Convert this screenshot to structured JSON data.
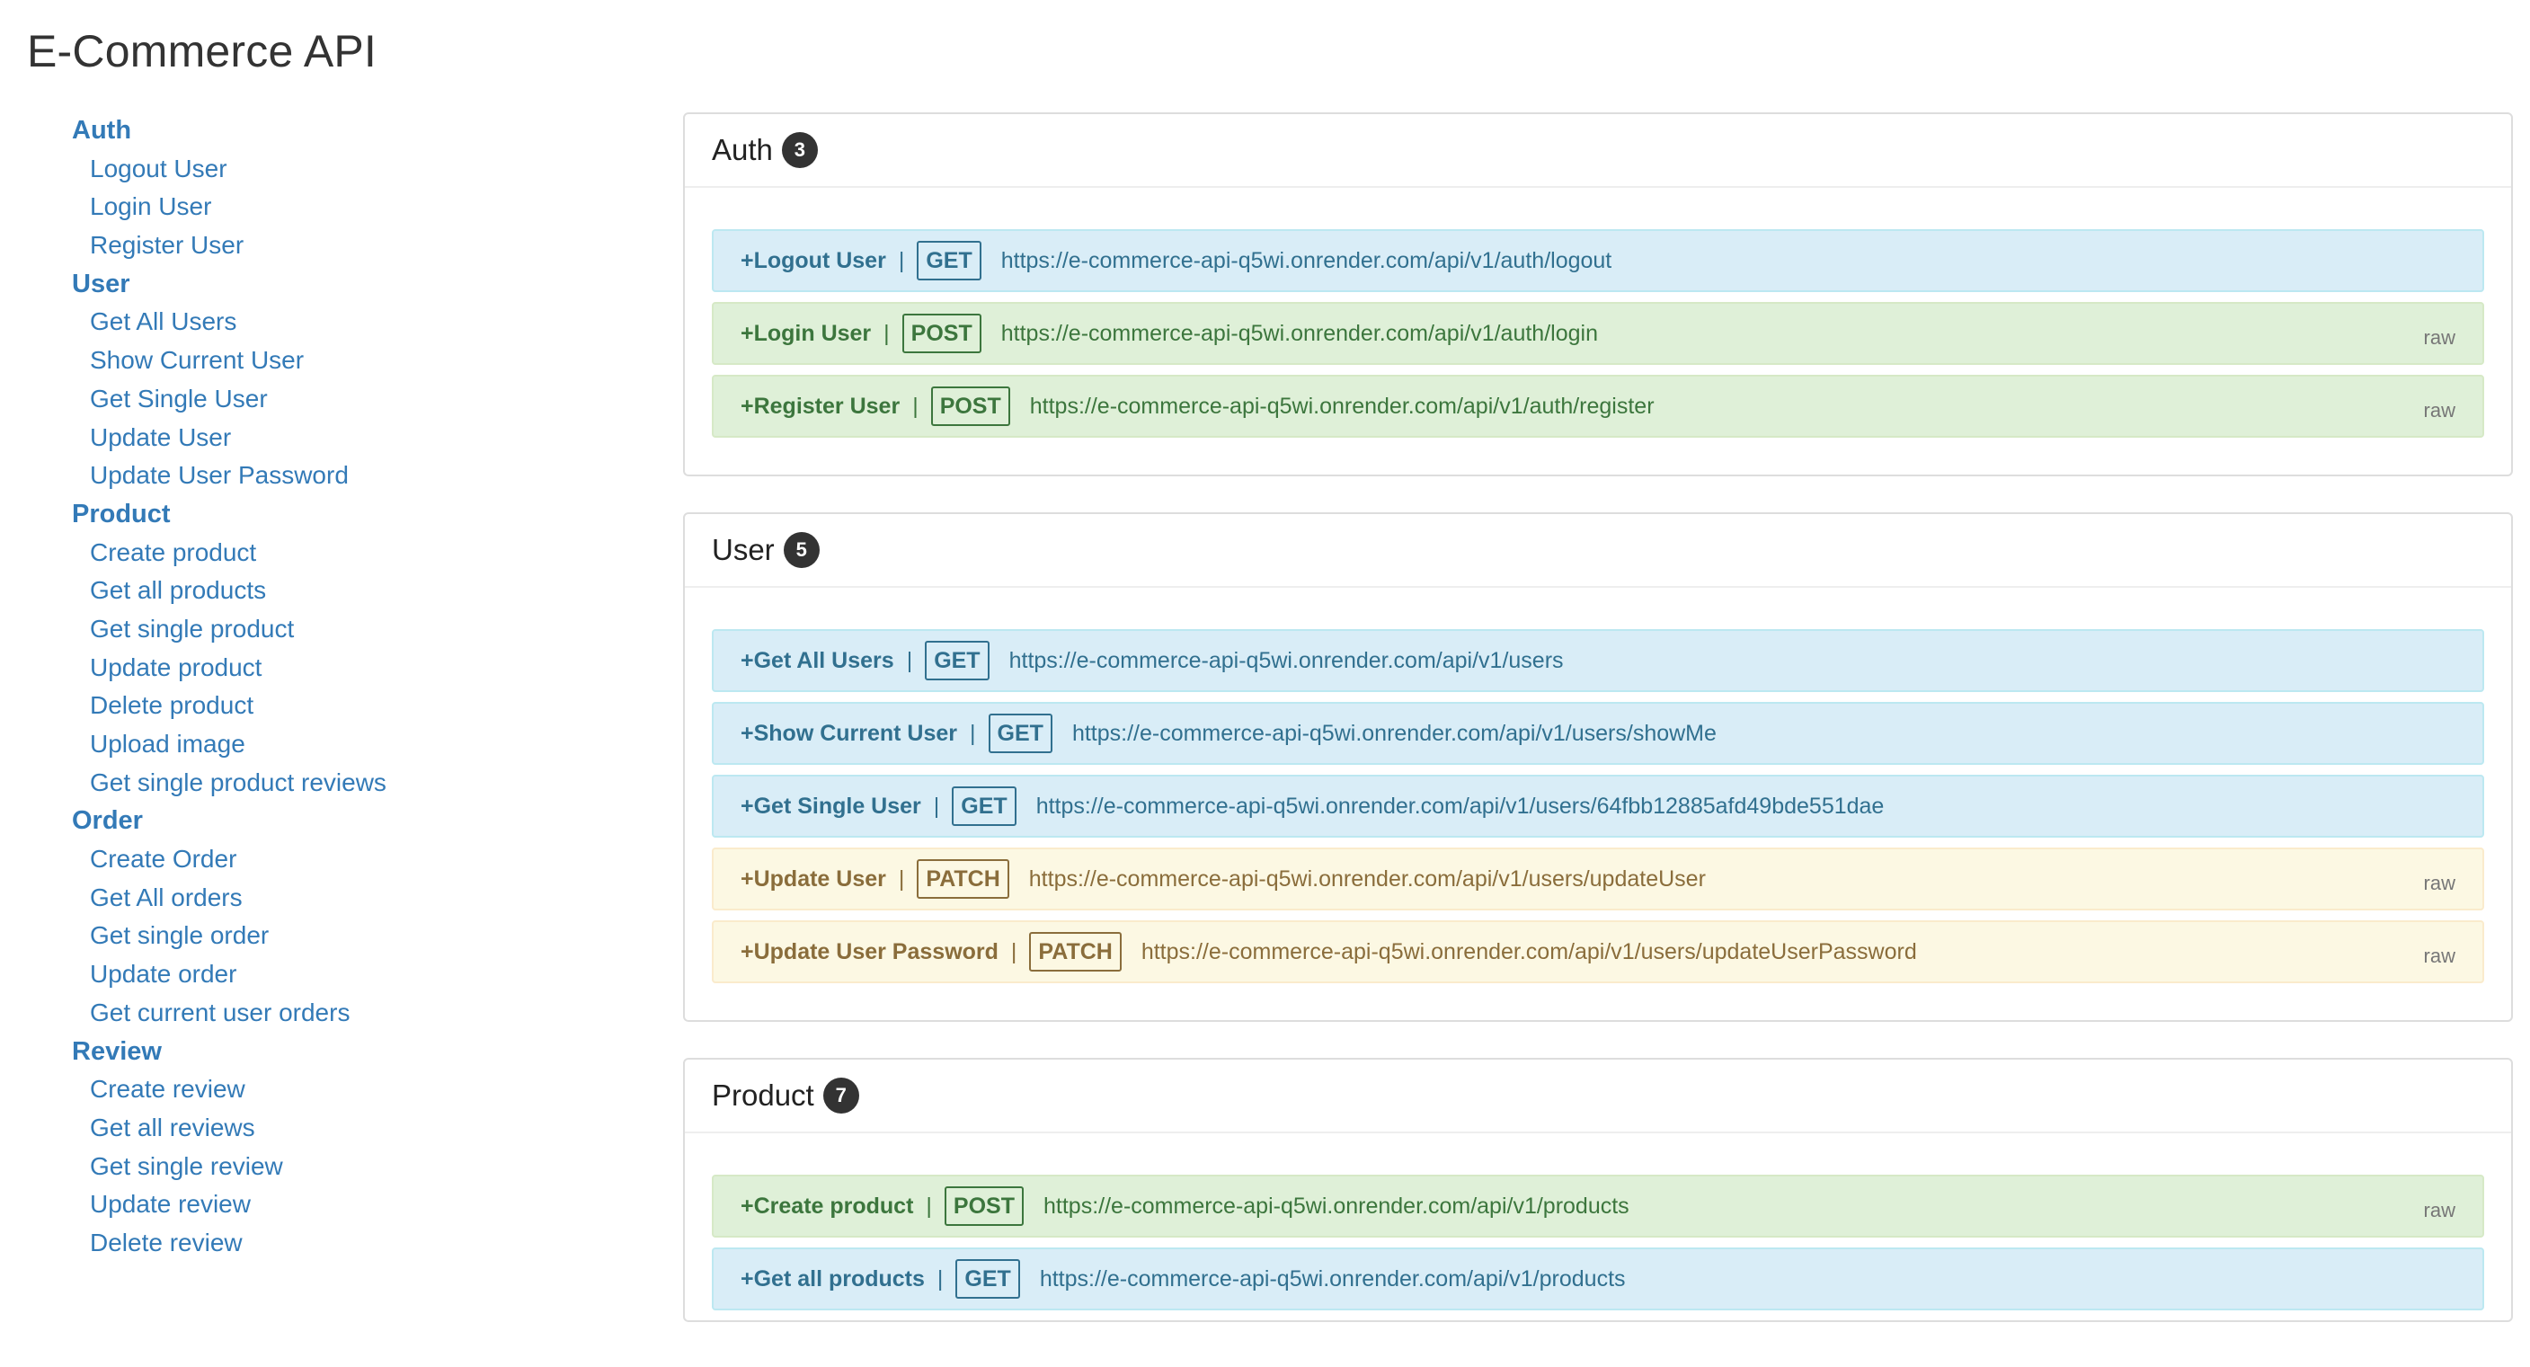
{
  "app": {
    "title": "E-Commerce API"
  },
  "sidebar": {
    "groups": [
      {
        "title": "Auth",
        "items": [
          "Logout User",
          "Login User",
          "Register User"
        ]
      },
      {
        "title": "User",
        "items": [
          "Get All Users",
          "Show Current User",
          "Get Single User",
          "Update User",
          "Update User Password"
        ]
      },
      {
        "title": "Product",
        "items": [
          "Create product",
          "Get all products",
          "Get single product",
          "Update product",
          "Delete product",
          "Upload image",
          "Get single product reviews"
        ]
      },
      {
        "title": "Order",
        "items": [
          "Create Order",
          "Get All orders",
          "Get single order",
          "Update order",
          "Get current user orders"
        ]
      },
      {
        "title": "Review",
        "items": [
          "Create review",
          "Get all reviews",
          "Get single review",
          "Update review",
          "Delete review"
        ]
      }
    ]
  },
  "sections": [
    {
      "title": "Auth",
      "count": "3",
      "endpoints": [
        {
          "name": "+Logout User",
          "method": "GET",
          "url": "https://e-commerce-api-q5wi.onrender.com/api/v1/auth/logout",
          "raw": ""
        },
        {
          "name": "+Login User",
          "method": "POST",
          "url": "https://e-commerce-api-q5wi.onrender.com/api/v1/auth/login",
          "raw": "raw"
        },
        {
          "name": "+Register User",
          "method": "POST",
          "url": "https://e-commerce-api-q5wi.onrender.com/api/v1/auth/register",
          "raw": "raw"
        }
      ]
    },
    {
      "title": "User",
      "count": "5",
      "endpoints": [
        {
          "name": "+Get All Users",
          "method": "GET",
          "url": "https://e-commerce-api-q5wi.onrender.com/api/v1/users",
          "raw": ""
        },
        {
          "name": "+Show Current User",
          "method": "GET",
          "url": "https://e-commerce-api-q5wi.onrender.com/api/v1/users/showMe",
          "raw": ""
        },
        {
          "name": "+Get Single User",
          "method": "GET",
          "url": "https://e-commerce-api-q5wi.onrender.com/api/v1/users/64fbb12885afd49bde551dae",
          "raw": ""
        },
        {
          "name": "+Update User",
          "method": "PATCH",
          "url": "https://e-commerce-api-q5wi.onrender.com/api/v1/users/updateUser",
          "raw": "raw"
        },
        {
          "name": "+Update User Password",
          "method": "PATCH",
          "url": "https://e-commerce-api-q5wi.onrender.com/api/v1/users/updateUserPassword",
          "raw": "raw"
        }
      ]
    },
    {
      "title": "Product",
      "count": "7",
      "endpoints": [
        {
          "name": "+Create product",
          "method": "POST",
          "url": "https://e-commerce-api-q5wi.onrender.com/api/v1/products",
          "raw": "raw"
        },
        {
          "name": "+Get all products",
          "method": "GET",
          "url": "https://e-commerce-api-q5wi.onrender.com/api/v1/products",
          "raw": ""
        }
      ]
    }
  ]
}
